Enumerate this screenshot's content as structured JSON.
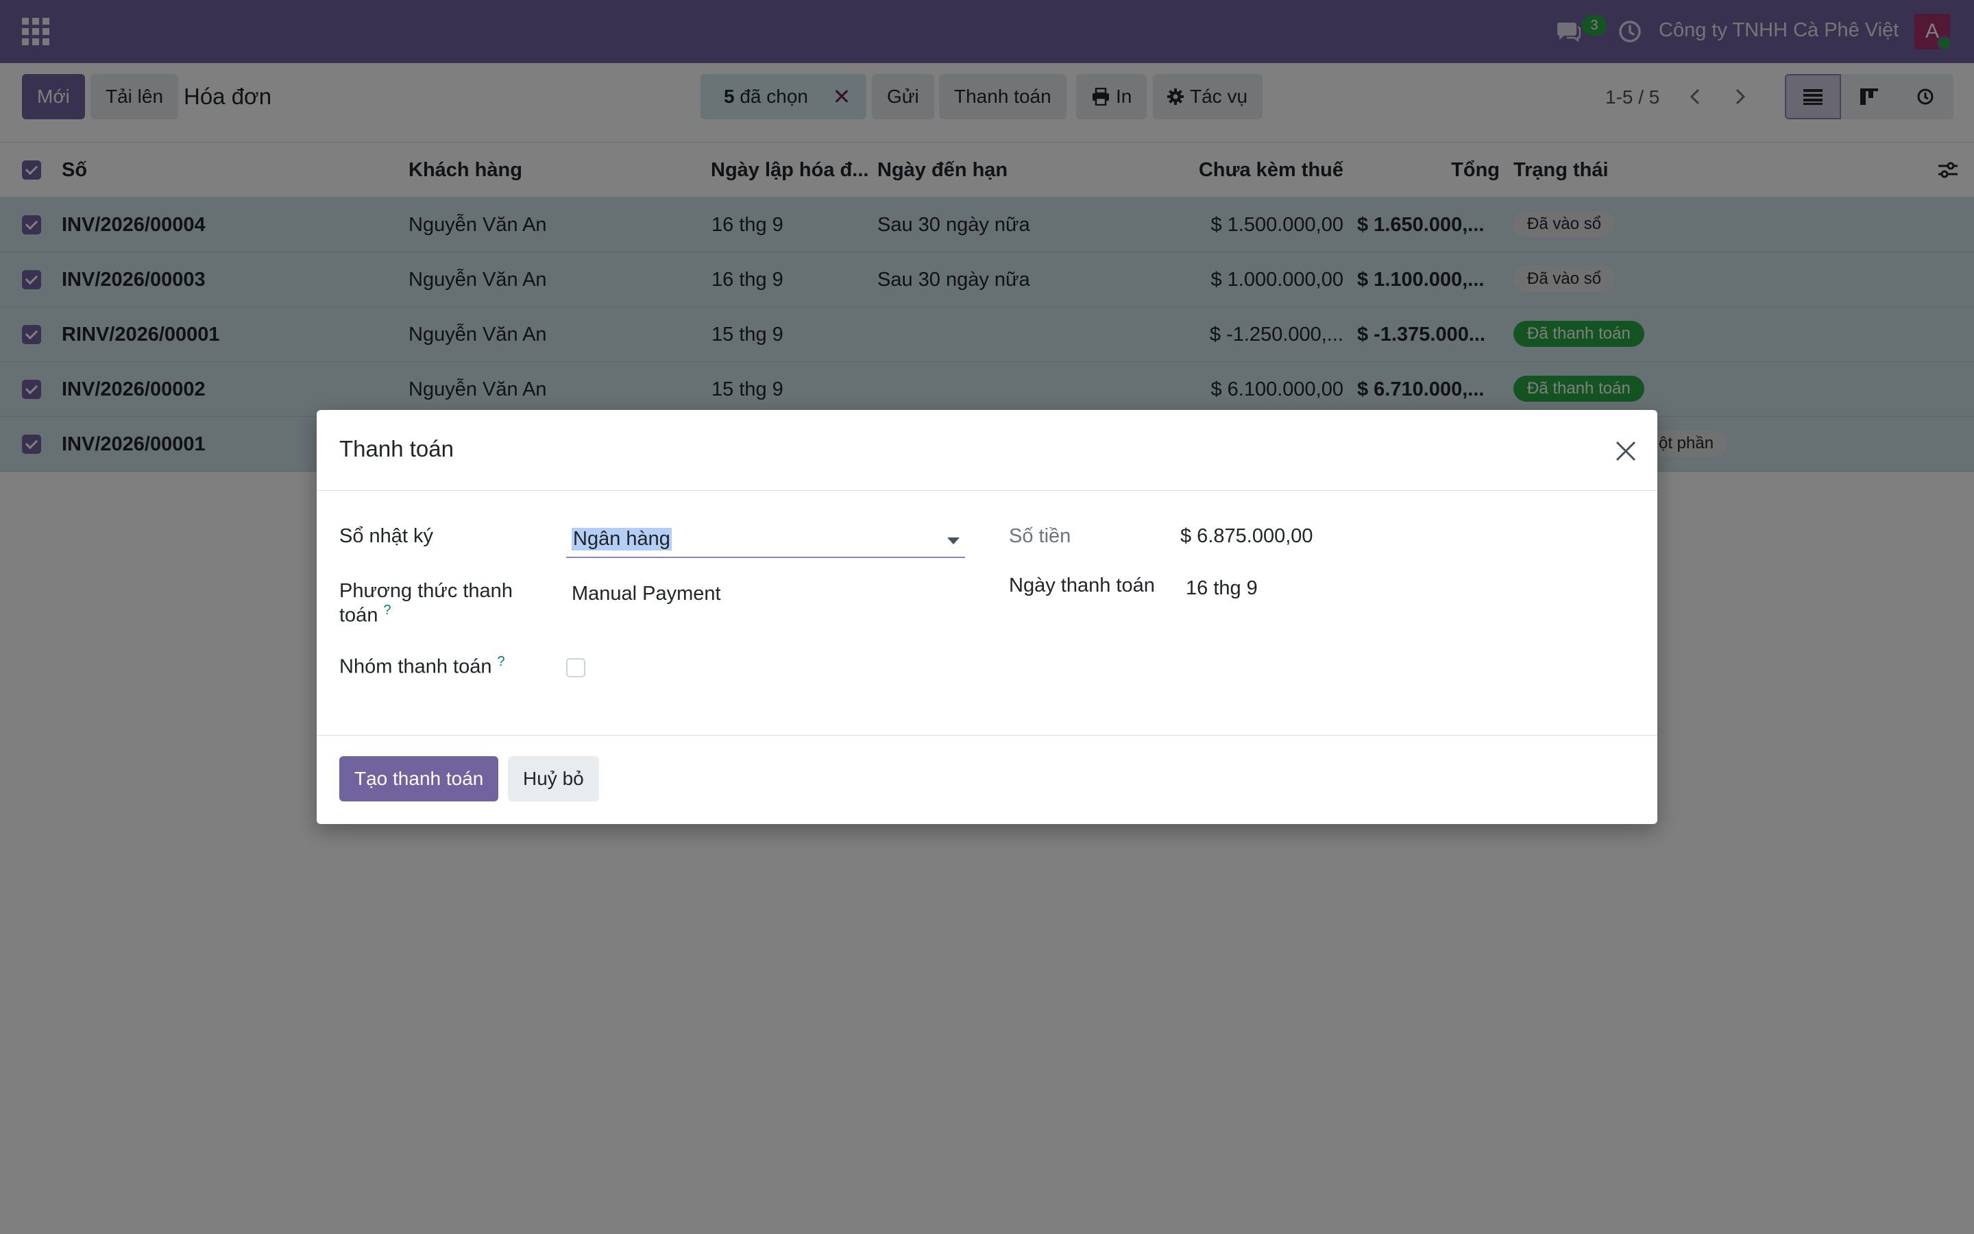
{
  "navbar": {
    "message_count": "3",
    "company": "Công ty TNHH Cà Phê Việt",
    "avatar_letter": "A",
    "colors": {
      "brand": "#71639e",
      "success": "#28a745",
      "avatar": "#a6306b"
    }
  },
  "control": {
    "new_label": "Mới",
    "upload_label": "Tải lên",
    "breadcrumb": "Hóa đơn",
    "selected_count": "5",
    "selected_suffix": "đã chọn",
    "send_label": "Gửi",
    "payment_label": "Thanh toán",
    "print_label": "In",
    "actions_label": "Tác vụ",
    "pager": "1-5 / 5"
  },
  "table": {
    "headers": {
      "number": "Số",
      "customer": "Khách hàng",
      "invoice_date": "Ngày lập hóa đ...",
      "due_date": "Ngày đến hạn",
      "untaxed": "Chưa kèm thuế",
      "total": "Tổng",
      "status": "Trạng thái"
    },
    "rows": [
      {
        "number": "INV/2026/00004",
        "customer": "Nguyễn Văn An",
        "invoice_date": "16 thg 9",
        "due_date": "Sau 30 ngày nữa",
        "untaxed": "$ 1.500.000,00",
        "total": "$ 1.650.000,...",
        "status": "Đã vào sổ",
        "status_type": "posted"
      },
      {
        "number": "INV/2026/00003",
        "customer": "Nguyễn Văn An",
        "invoice_date": "16 thg 9",
        "due_date": "Sau 30 ngày nữa",
        "untaxed": "$ 1.000.000,00",
        "total": "$ 1.100.000,...",
        "status": "Đã vào sổ",
        "status_type": "posted"
      },
      {
        "number": "RINV/2026/00001",
        "customer": "Nguyễn Văn An",
        "invoice_date": "15 thg 9",
        "due_date": "",
        "untaxed": "$ -1.250.000,...",
        "total": "$ -1.375.000...",
        "status": "Đã thanh toán",
        "status_type": "paid"
      },
      {
        "number": "INV/2026/00002",
        "customer": "Nguyễn Văn An",
        "invoice_date": "15 thg 9",
        "due_date": "",
        "untaxed": "$ 6.100.000,00",
        "total": "$ 6.710.000,...",
        "status": "Đã thanh toán",
        "status_type": "paid"
      },
      {
        "number": "INV/2026/00001",
        "customer": "",
        "invoice_date": "",
        "due_date": "",
        "untaxed": "",
        "total": "",
        "status": "ột phần",
        "status_type": "partial"
      }
    ]
  },
  "modal": {
    "title": "Thanh toán",
    "journal_label": "Sổ nhật ký",
    "journal_value": "Ngân hàng",
    "method_label_line1": "Phương thức thanh",
    "method_label_line2": "toán",
    "method_value": "Manual Payment",
    "group_label": "Nhóm thanh toán",
    "help_mark": "?",
    "amount_label": "Số tiền",
    "amount_value": "$ 6.875.000,00",
    "date_label": "Ngày thanh toán",
    "date_value": "16 thg 9",
    "create_label": "Tạo thanh toán",
    "cancel_label": "Huỷ bỏ"
  }
}
